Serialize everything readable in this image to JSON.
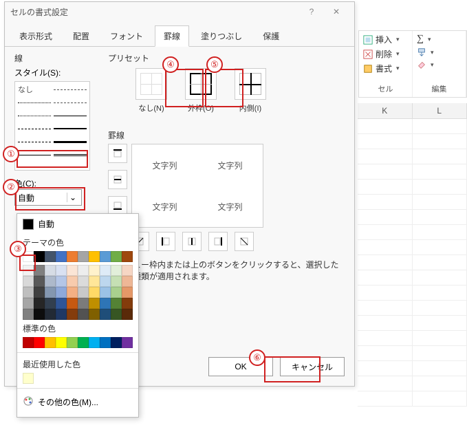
{
  "dialog": {
    "title": "セルの書式設定",
    "tabs": [
      "表示形式",
      "配置",
      "フォント",
      "罫線",
      "塗りつぶし",
      "保護"
    ],
    "active_tab_index": 3,
    "line": {
      "section": "線",
      "style_label": "スタイル(S):",
      "none_label": "なし",
      "color_label": "色(C):",
      "color_value": "自動"
    },
    "preset": {
      "section": "プリセット",
      "items": [
        {
          "label": "なし(N)"
        },
        {
          "label": "外枠(O)"
        },
        {
          "label": "内側(I)"
        }
      ]
    },
    "border": {
      "section": "罫線",
      "preview_cells": [
        "文字列",
        "文字列",
        "文字列",
        "文字列"
      ]
    },
    "help": "プレビュー枠内または上のボタンをクリックすると、選択した罫線の種類が適用されます。",
    "ok": "OK",
    "cancel": "キャンセル"
  },
  "color_popup": {
    "auto": "自動",
    "theme": "テーマの色",
    "theme_colors_row1": [
      "#ffffff",
      "#000000",
      "#44546a",
      "#4472c4",
      "#ed7d31",
      "#a5a5a5",
      "#ffc000",
      "#5b9bd5",
      "#70ad47",
      "#9e480e"
    ],
    "theme_shades": [
      [
        "#f2f2f2",
        "#808080",
        "#d6dce5",
        "#d9e1f2",
        "#fbe5d6",
        "#ededed",
        "#fff2cc",
        "#deebf7",
        "#e2efda",
        "#f6d6c4"
      ],
      [
        "#d9d9d9",
        "#595959",
        "#adb9cb",
        "#b4c6e7",
        "#f8cbad",
        "#dbdbdb",
        "#ffe699",
        "#bdd7ee",
        "#c6e0b4",
        "#eeb796"
      ],
      [
        "#bfbfbf",
        "#404040",
        "#8497b0",
        "#8ea9db",
        "#f4b084",
        "#c9c9c9",
        "#ffd966",
        "#9bc2e6",
        "#a9d08e",
        "#e59868"
      ],
      [
        "#a6a6a6",
        "#262626",
        "#323f4f",
        "#2f5597",
        "#c65911",
        "#7b7b7b",
        "#bf8f00",
        "#2e75b6",
        "#548235",
        "#833c0c"
      ],
      [
        "#808080",
        "#0d0d0d",
        "#222a35",
        "#1f3864",
        "#843c0c",
        "#525252",
        "#806000",
        "#1f4e79",
        "#375623",
        "#5a2a09"
      ]
    ],
    "standard": "標準の色",
    "standard_colors": [
      "#c00000",
      "#ff0000",
      "#ffc000",
      "#ffff00",
      "#92d050",
      "#00b050",
      "#00b0f0",
      "#0070c0",
      "#002060",
      "#7030a0"
    ],
    "recent": "最近使用した色",
    "recent_colors": [
      "#ffffcc"
    ],
    "more": "その他の色(M)..."
  },
  "ribbon": {
    "cells_group": {
      "insert": "挿入",
      "delete": "削除",
      "format": "書式",
      "footer": "セル"
    },
    "edit_group": {
      "footer": "編集"
    }
  },
  "sheet": {
    "cols": [
      "K",
      "L"
    ]
  },
  "annotations": [
    "①",
    "②",
    "③",
    "④",
    "⑤",
    "⑥"
  ]
}
